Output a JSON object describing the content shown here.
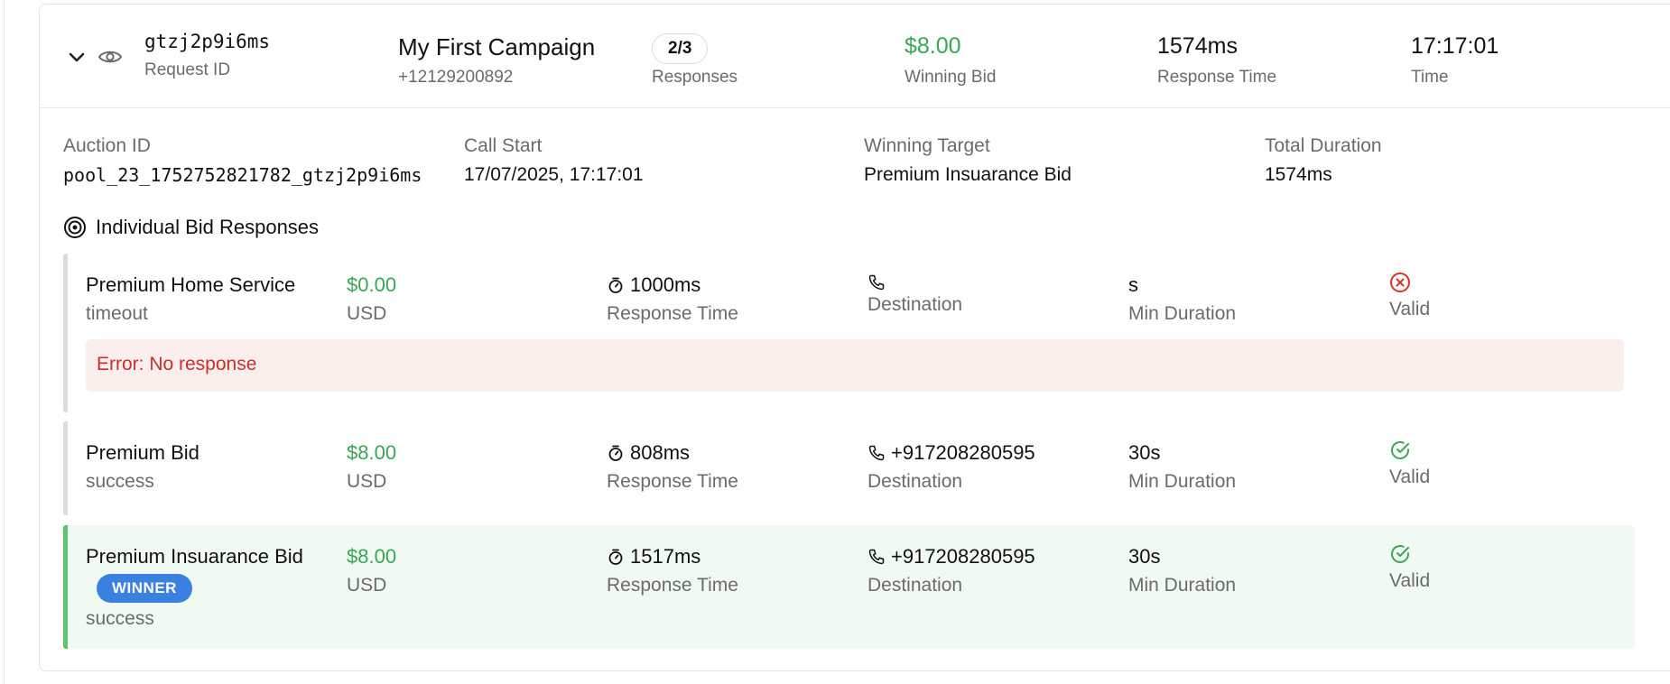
{
  "header": {
    "request_id": "gtzj2p9i6ms",
    "request_id_label": "Request ID",
    "campaign_name": "My First Campaign",
    "campaign_phone": "+12129200892",
    "responses_count": "2/3",
    "responses_label": "Responses",
    "winning_bid": "$8.00",
    "winning_bid_label": "Winning Bid",
    "response_time": "1574ms",
    "response_time_label": "Response Time",
    "time": "17:17:01",
    "time_label": "Time"
  },
  "auction": {
    "auction_id_label": "Auction ID",
    "auction_id": "pool_23_1752752821782_gtzj2p9i6ms",
    "call_start_label": "Call Start",
    "call_start": "17/07/2025, 17:17:01",
    "winning_target_label": "Winning Target",
    "winning_target": "Premium Insuarance Bid",
    "total_duration_label": "Total Duration",
    "total_duration": "1574ms"
  },
  "section_title": "Individual Bid Responses",
  "labels": {
    "currency": "USD",
    "response_time": "Response Time",
    "destination": "Destination",
    "min_duration": "Min Duration",
    "valid": "Valid",
    "winner": "WINNER"
  },
  "bids": [
    {
      "name": "Premium Home Service",
      "status": "timeout",
      "amount": "$0.00",
      "response_time": "1000ms",
      "destination": "",
      "min_duration": "s",
      "valid": false,
      "error": "Error: No response"
    },
    {
      "name": "Premium Bid",
      "status": "success",
      "amount": "$8.00",
      "response_time": "808ms",
      "destination": "+917208280595",
      "min_duration": "30s",
      "valid": true
    },
    {
      "name": "Premium Insuarance Bid",
      "status": "success",
      "amount": "$8.00",
      "response_time": "1517ms",
      "destination": "+917208280595",
      "min_duration": "30s",
      "valid": true,
      "winner": true
    }
  ],
  "colors": {
    "success_green": "#3aa655",
    "error_red": "#d9342b",
    "winner_blue": "#3b82e0",
    "winner_bg": "#f0faf2"
  }
}
